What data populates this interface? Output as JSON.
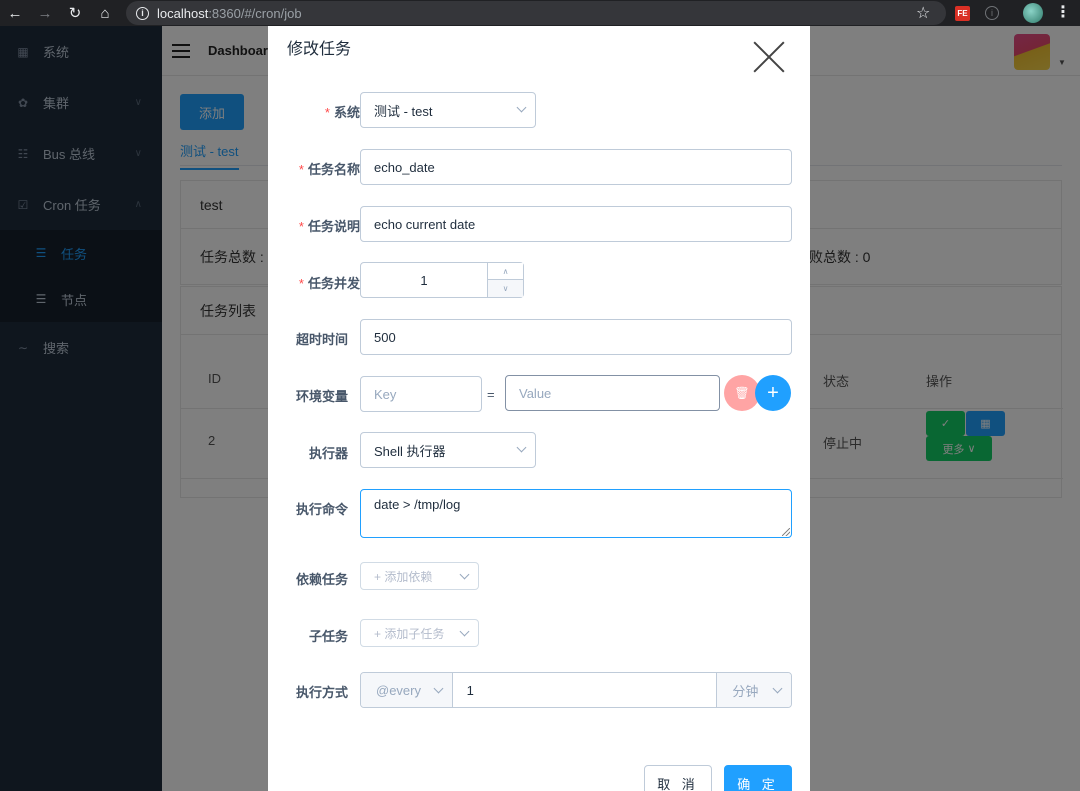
{
  "browser": {
    "url_host": "localhost",
    "url_path": ":8360/#/cron/job",
    "ext_label": "FE"
  },
  "sidebar": {
    "items": [
      {
        "label": "系统",
        "icon": "grid-icon"
      },
      {
        "label": "集群",
        "icon": "cluster-icon"
      },
      {
        "label": "Bus 总线",
        "icon": "bus-icon"
      },
      {
        "label": "Cron 任务",
        "icon": "calendar-check-icon"
      }
    ],
    "sub_items": [
      {
        "label": "任务",
        "icon": "list-icon",
        "active": true
      },
      {
        "label": "节点",
        "icon": "list-icon",
        "active": false
      }
    ],
    "search_label": "搜索"
  },
  "header": {
    "title": "Dashboard"
  },
  "page": {
    "add_label": "添加",
    "tab_label": "测试 - test",
    "system_name": "test",
    "task_total_label": "任务总数 :",
    "fail_total_label": "败总数 : 0",
    "task_list_label": "任务列表",
    "table": {
      "headers": [
        "ID",
        "状态",
        "操作"
      ],
      "row": {
        "id": "2",
        "status": "停止中",
        "more_label": "更多"
      }
    }
  },
  "dialog": {
    "title": "修改任务",
    "fields": {
      "system": {
        "label": "系统",
        "value": "测试 - test"
      },
      "name": {
        "label": "任务名称",
        "value": "echo_date"
      },
      "desc": {
        "label": "任务说明",
        "value": "echo current date"
      },
      "concurrency": {
        "label": "任务并发",
        "value": "1"
      },
      "timeout": {
        "label": "超时时间",
        "value": "500"
      },
      "env": {
        "label": "环境变量",
        "key_placeholder": "Key",
        "eq": "=",
        "value_placeholder": "Value"
      },
      "executor": {
        "label": "执行器",
        "value": "Shell 执行器"
      },
      "command": {
        "label": "执行命令",
        "value": "date > /tmp/log"
      },
      "depends": {
        "label": "依赖任务",
        "placeholder": "+ 添加依赖"
      },
      "children": {
        "label": "子任务",
        "placeholder": "+ 添加子任务"
      },
      "schedule": {
        "label": "执行方式",
        "mode": "@every",
        "value": "1",
        "unit": "分钟"
      }
    },
    "cancel_label": "取 消",
    "ok_label": "确 定"
  },
  "colors": {
    "primary": "#20a0ff",
    "danger": "#ff4949",
    "success": "#13ce66",
    "sidebar": "#1f2d3d"
  }
}
